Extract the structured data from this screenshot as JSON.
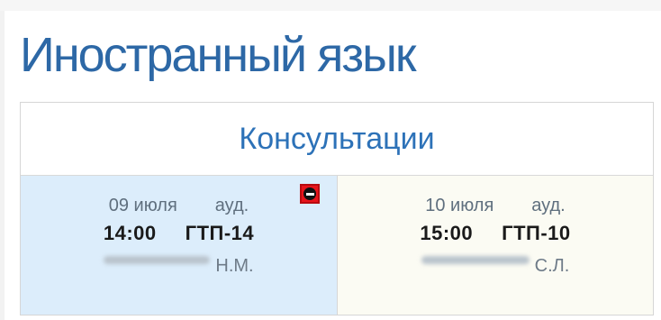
{
  "page": {
    "title": "Иностранный язык"
  },
  "card": {
    "header": "Консультации"
  },
  "consultations": [
    {
      "date": "09 июля",
      "room_label": "ауд.",
      "time": "14:00",
      "room": "ГТП-14",
      "teacher_initials": "Н.М."
    },
    {
      "date": "10 июля",
      "room_label": "ауд.",
      "time": "15:00",
      "room": "ГТП-10",
      "teacher_initials": "С.Л."
    }
  ],
  "controls": {
    "cancel_icon": "minus-circle-icon",
    "cancel_color": "#e8141b"
  }
}
